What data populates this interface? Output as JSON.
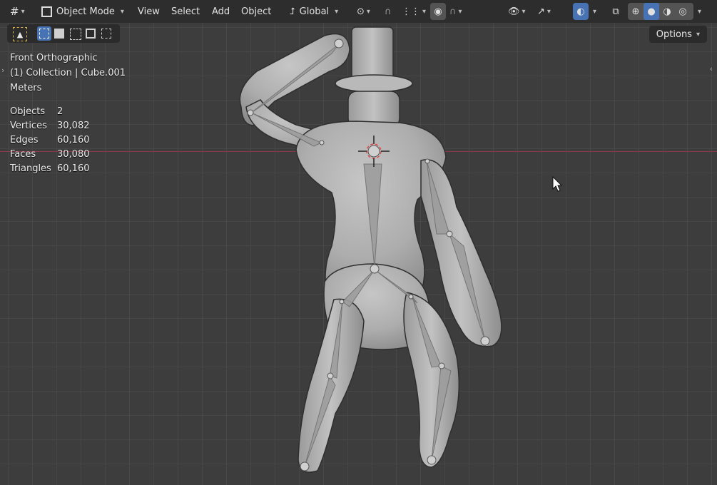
{
  "header": {
    "editor_type_icon": "grid-editor-icon",
    "mode_label": "Object Mode",
    "menus": [
      "View",
      "Select",
      "Add",
      "Object"
    ],
    "transform_orientation": "Global",
    "options_label": "Options"
  },
  "overlay_text": {
    "view_name": "Front Orthographic",
    "collection": "(1) Collection | Cube.001",
    "units": "Meters"
  },
  "stats": [
    {
      "label": "Objects",
      "value": "2"
    },
    {
      "label": "Vertices",
      "value": "30,082"
    },
    {
      "label": "Edges",
      "value": "60,160"
    },
    {
      "label": "Faces",
      "value": "30,080"
    },
    {
      "label": "Triangles",
      "value": "60,160"
    }
  ],
  "colors": {
    "header_bg": "#2d2d2d",
    "viewport_bg": "#3d3d3d",
    "active_blue": "#4772b3",
    "x_axis": "#8c3a49",
    "mesh_light": "#b5b5b5",
    "mesh_dark": "#8a8a8a"
  }
}
